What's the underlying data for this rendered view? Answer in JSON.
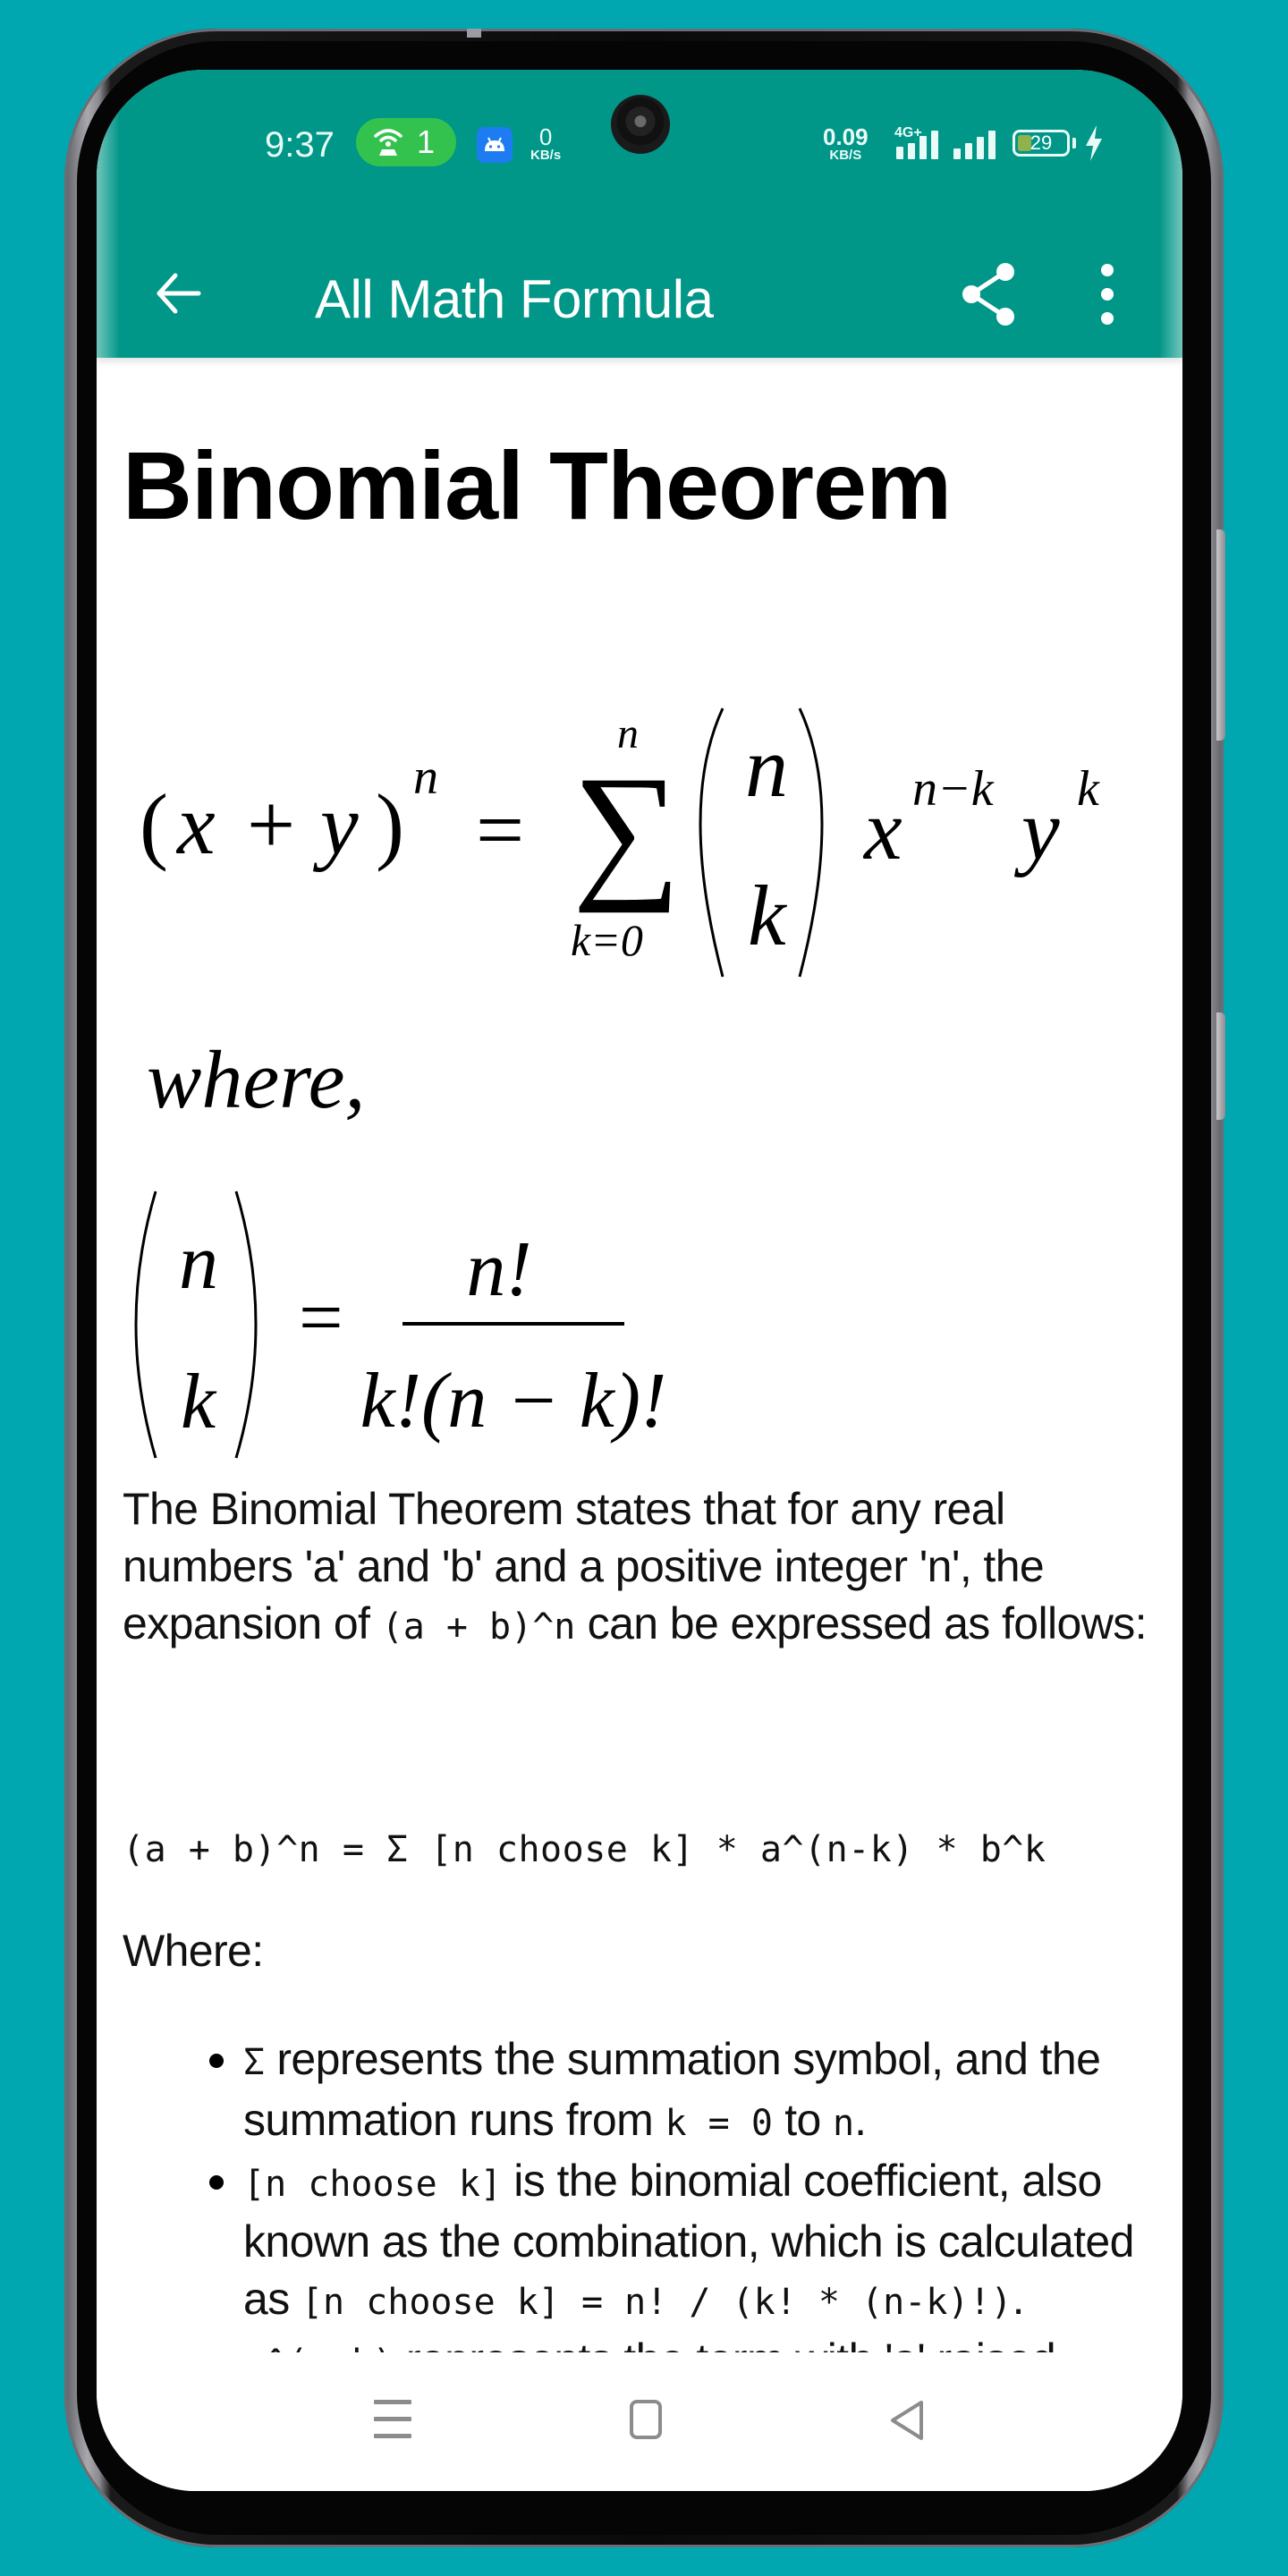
{
  "status_bar": {
    "time": "9:37",
    "hotspot_count": "1",
    "left_speed_value": "0",
    "left_speed_unit": "KB/s",
    "right_speed_value": "0.09",
    "right_speed_unit": "KB/S",
    "network_type": "4G+",
    "battery_percent": "29",
    "battery_level": 0.29,
    "charging": true,
    "icons": [
      "hotspot-icon",
      "android-notification-icon",
      "signal-icon",
      "signal-icon",
      "battery-icon",
      "charging-bolt-icon"
    ]
  },
  "app_bar": {
    "title": "All Math Formula",
    "back_icon": "arrow-left-icon",
    "share_icon": "share-icon",
    "more_icon": "more-vertical-icon",
    "color": "#009688"
  },
  "article": {
    "title": "Binomial Theorem",
    "formula": {
      "lhs_base": "(x + y)",
      "lhs_exp": "n",
      "equals": "=",
      "sum_upper": "n",
      "sum_symbol": "∑",
      "sum_lower": "k=0",
      "binom_top": "n",
      "binom_bottom": "k",
      "x_base": "x",
      "x_exp": "n−k",
      "y_base": "y",
      "y_exp": "k"
    },
    "where_label": "where,",
    "coefficient": {
      "binom_top": "n",
      "binom_bottom": "k",
      "equals": "=",
      "numerator": "n!",
      "denominator": "k!(n − k)!"
    },
    "paragraph": {
      "before_code": "The Binomial Theorem states that for any real numbers 'a' and 'b' and a positive integer 'n', the expansion of ",
      "code": "(a + b)^n",
      "after_code": " can be expressed as follows:"
    },
    "code_line": "(a + b)^n = Σ [n choose k] * a^(n-k) * b^k",
    "where_heading": "Where:",
    "bullets": [
      {
        "code1": "Σ",
        "text1": " represents the summation symbol, and the summation runs from ",
        "code2": "k = 0",
        "text2": " to ",
        "code3": "n",
        "text3": "."
      },
      {
        "code1": "[n choose k]",
        "text1": " is the binomial coefficient, also known as the combination, which is calculated as ",
        "code2": "[n choose k] = n! / (k! * (n-k)!)",
        "text2": "."
      },
      {
        "code1": "a^(n-k)",
        "text1": " represents the term with 'a' raised"
      }
    ]
  },
  "nav_bar": {
    "recents_icon": "recents-icon",
    "home_icon": "home-icon",
    "back_icon": "back-triangle-icon"
  }
}
